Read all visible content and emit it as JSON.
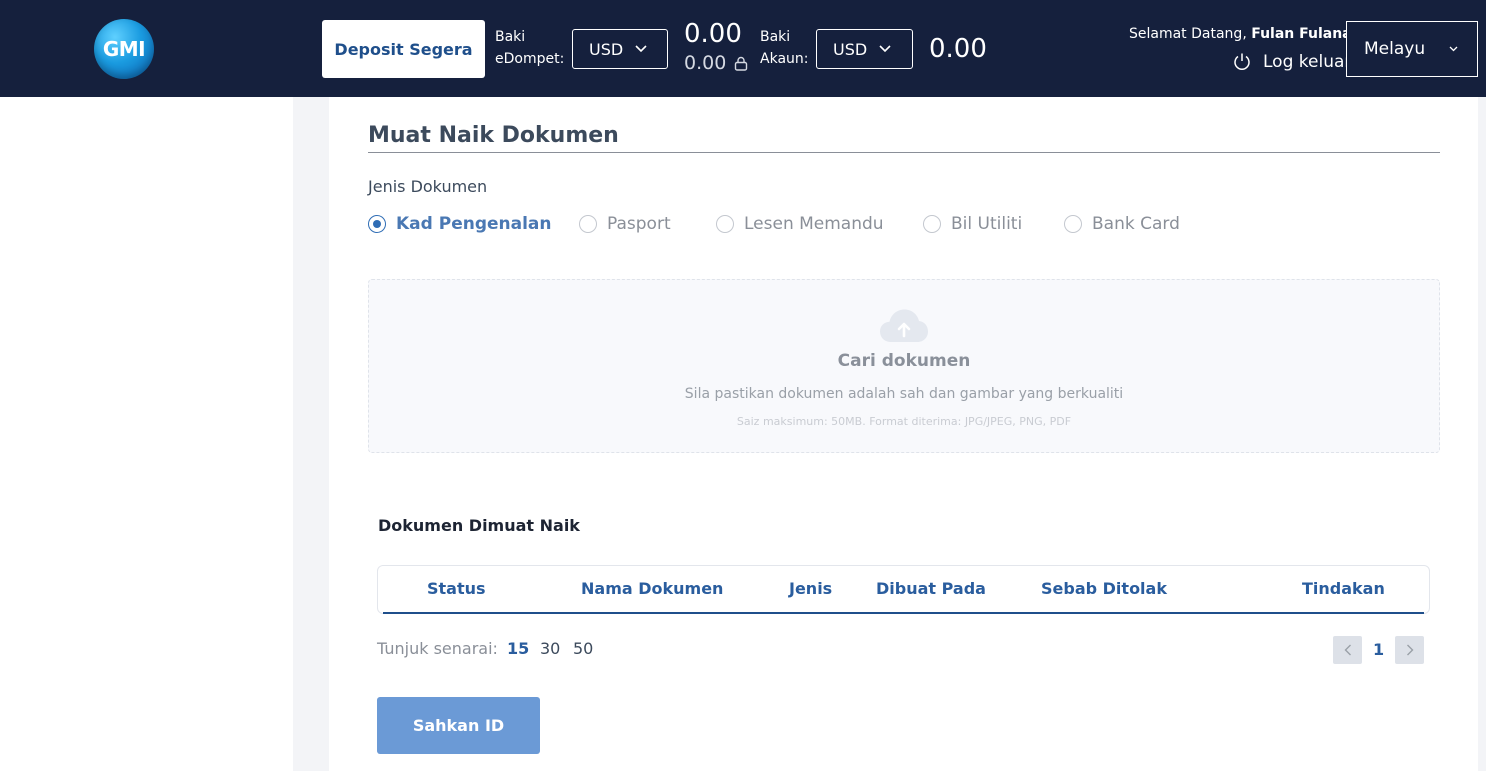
{
  "header": {
    "logo_text": "GMI",
    "deposit_label": "Deposit Segera",
    "wallet": {
      "label_line1": "Baki",
      "label_line2": "eDompet:",
      "currency": "USD",
      "amount": "0.00",
      "locked_amount": "0.00"
    },
    "account": {
      "label_line1": "Baki",
      "label_line2": "Akaun:",
      "currency": "USD",
      "amount": "0.00"
    },
    "welcome_prefix": "Selamat Datang,",
    "user_name": "Fulan Fulanah",
    "logout_label": "Log keluar",
    "language": "Melayu",
    "colors": {
      "bar": "#15203d",
      "accent": "#1f4f8b"
    }
  },
  "upload": {
    "title": "Muat Naik Dokumen",
    "doc_type_label": "Jenis Dokumen",
    "doc_types": [
      {
        "label": "Kad Pengenalan",
        "checked": true
      },
      {
        "label": "Pasport",
        "checked": false
      },
      {
        "label": "Lesen Memandu",
        "checked": false
      },
      {
        "label": "Bil Utiliti",
        "checked": false
      },
      {
        "label": "Bank Card",
        "checked": false
      }
    ],
    "dropzone": {
      "icon": "cloud-upload-icon",
      "title": "Cari dokumen",
      "subtitle": "Sila pastikan dokumen adalah sah dan gambar yang berkualiti",
      "hint": "Saiz maksimum: 50MB. Format diterima: JPG/JPEG, PNG, PDF"
    }
  },
  "uploaded": {
    "title": "Dokumen Dimuat Naik",
    "columns": [
      "Status",
      "Nama Dokumen",
      "Jenis",
      "Dibuat Pada",
      "Sebab Ditolak",
      "Tindakan"
    ],
    "rows": []
  },
  "pagination": {
    "show_label": "Tunjuk senarai:",
    "page_sizes": [
      "15",
      "30",
      "50"
    ],
    "active_page_size": "15",
    "current_page": "1"
  },
  "verify_label": "Sahkan ID"
}
